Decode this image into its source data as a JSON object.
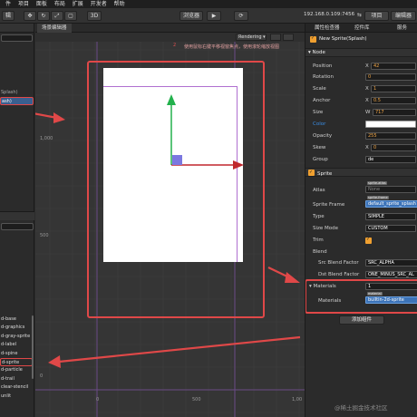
{
  "menubar": {
    "items": [
      "件",
      "项目",
      "面板",
      "布局",
      "扩展",
      "开发者",
      "帮助"
    ]
  },
  "toolbar": {
    "left_label": "辑",
    "mode_3d": "3D",
    "preview_select": "浏览器",
    "play_icon": "play-icon",
    "ip_address": "192.168.0.109:7456",
    "project_button": "项目",
    "editor_button": "编辑器"
  },
  "scene": {
    "tab_label": "场景编辑器",
    "rendering_select": "Rendering",
    "hint_text": "使用鼠标右键平移视窗焦点，使用滚轮缩放视图",
    "marker": "2",
    "axis_labels": {
      "y1000": "1,000",
      "y500": "500",
      "x0": "0",
      "x500": "500",
      "x1000": "1,00",
      "y0": "0"
    }
  },
  "left_panel": {
    "tree_items": [
      {
        "label": "Splash)",
        "selected": false
      },
      {
        "label": "ash)",
        "selected": true
      }
    ],
    "assets": [
      {
        "label": "d-base",
        "highlighted": false
      },
      {
        "label": "d-graphics",
        "highlighted": false
      },
      {
        "label": "d-gray-sprite",
        "highlighted": false
      },
      {
        "label": "d-label",
        "highlighted": false
      },
      {
        "label": "d-spine",
        "highlighted": false
      },
      {
        "label": "d-sprite",
        "highlighted": true
      },
      {
        "label": "d-particle",
        "highlighted": false
      },
      {
        "label": "d-trail",
        "highlighted": false
      },
      {
        "label": "clear-stencil",
        "highlighted": false
      },
      {
        "label": "unlit",
        "highlighted": false
      }
    ]
  },
  "inspector": {
    "tabs": [
      "属性检查器",
      "控件库",
      "服务"
    ],
    "node_name": "New Sprite(Splash)",
    "node_section": "Node",
    "position": {
      "label": "Position",
      "x": "42"
    },
    "rotation": {
      "label": "Rotation",
      "value": "0"
    },
    "scale": {
      "label": "Scale",
      "x": "1"
    },
    "anchor": {
      "label": "Anchor",
      "x": "0.5"
    },
    "size": {
      "label": "Size",
      "w": "717"
    },
    "color": {
      "label": "Color",
      "value": "#ffffff"
    },
    "opacity": {
      "label": "Opacity",
      "value": "255"
    },
    "skew": {
      "label": "Skew",
      "x": "0"
    },
    "group": {
      "label": "Group",
      "value": "de"
    },
    "sprite_section": "Sprite",
    "atlas": {
      "label": "Atlas",
      "badge": "sprite-atlas",
      "value": "None"
    },
    "sprite_frame": {
      "label": "Sprite Frame",
      "badge": "sprite-frame",
      "value": "default_sprite_splash"
    },
    "type": {
      "label": "Type",
      "value": "SIMPLE"
    },
    "size_mode": {
      "label": "Size Mode",
      "value": "CUSTOM"
    },
    "trim": {
      "label": "Trim"
    },
    "blend": {
      "label": "Blend"
    },
    "src_blend": {
      "label": "Src Blend Factor",
      "value": "SRC_ALPHA"
    },
    "dst_blend": {
      "label": "Dst Blend Factor",
      "value": "ONE_MINUS_SRC_AL"
    },
    "materials_count": {
      "label": "Materials",
      "value": "1"
    },
    "materials": {
      "label": "Materials",
      "badge": "material",
      "value": "builtin-2d-sprite"
    },
    "add_component": "添加组件",
    "axis": {
      "x": "X",
      "w": "W"
    }
  },
  "watermark": "@稀土掘金技术社区"
}
